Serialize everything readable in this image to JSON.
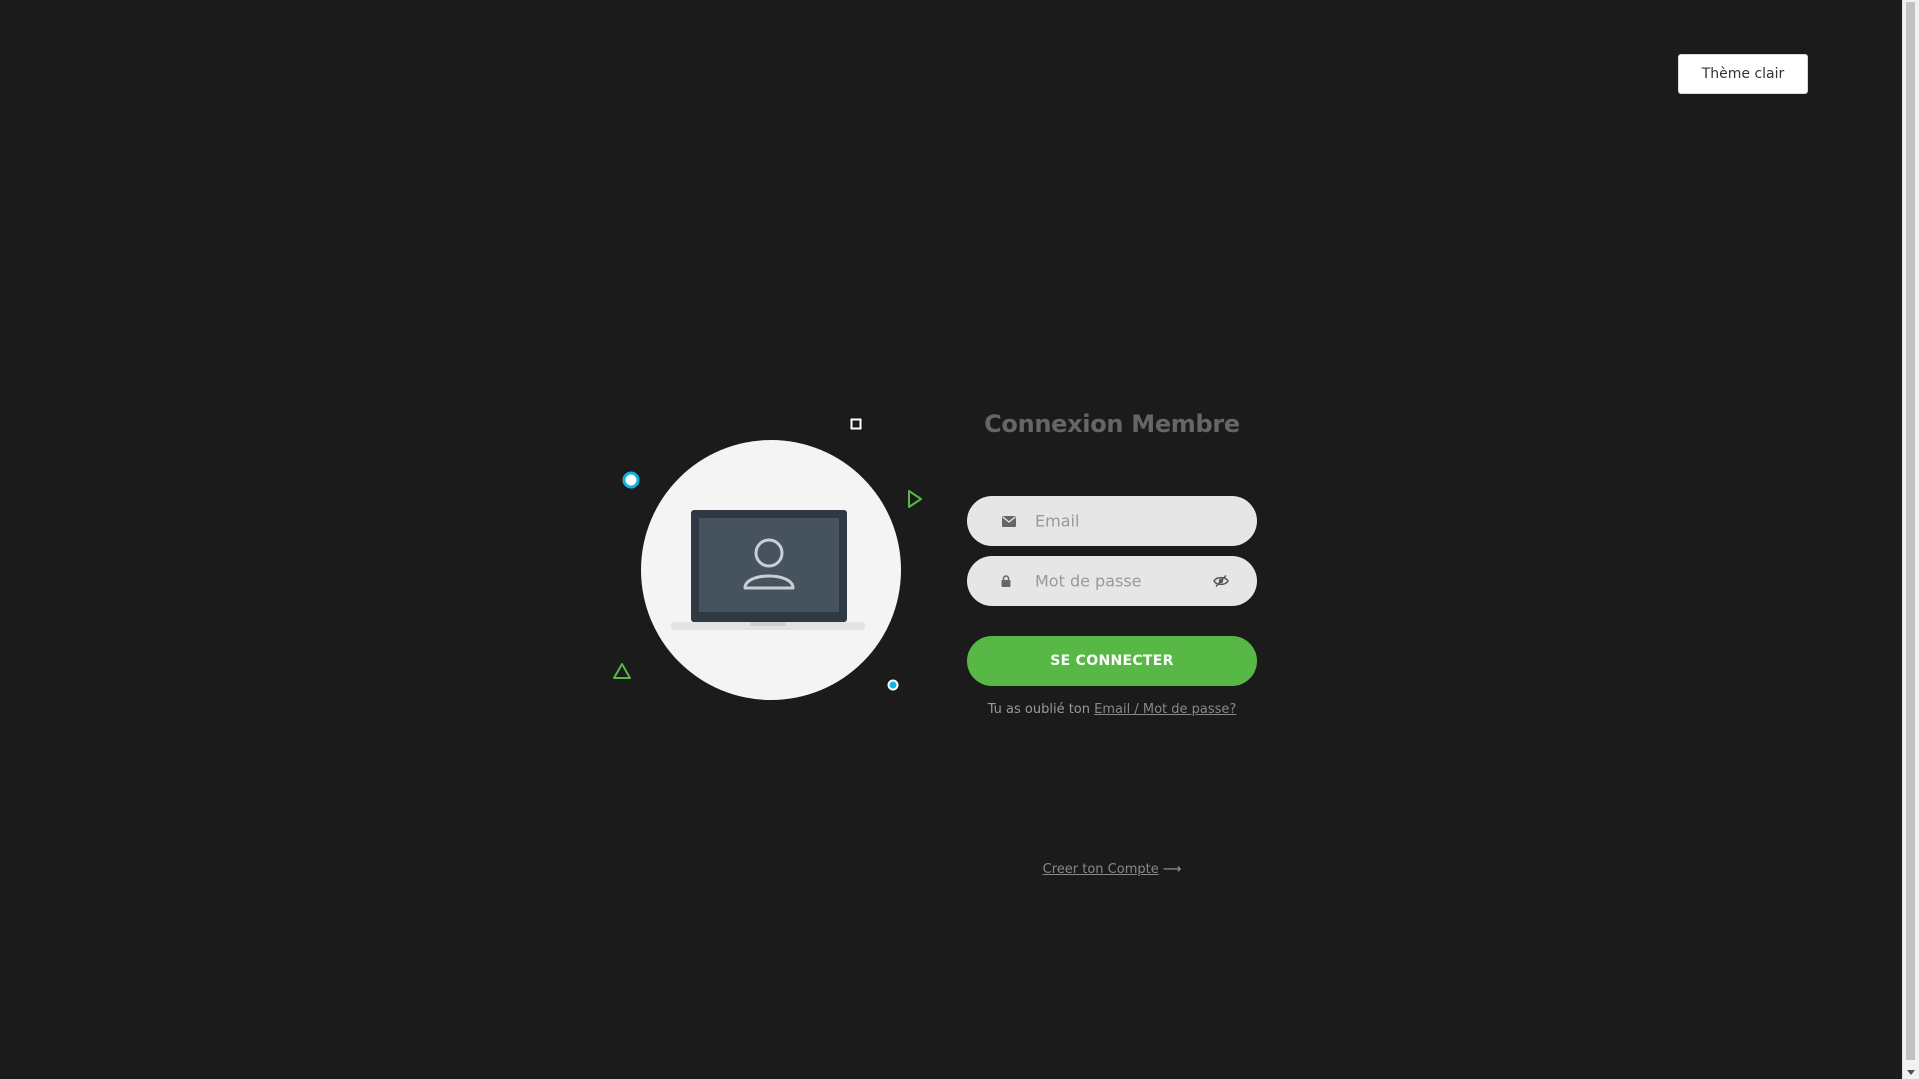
{
  "theme_toggle": {
    "label": "Thème clair"
  },
  "login": {
    "title": "Connexion Membre",
    "email": {
      "placeholder": "Email",
      "icon": "envelope-icon"
    },
    "password": {
      "placeholder": "Mot de passe",
      "icon": "lock-icon",
      "toggle_icon": "eye-slash-icon"
    },
    "submit_label": "SE CONNECTER",
    "forgot_prefix": "Tu as oublié ton",
    "forgot_link": "Email / Mot de passe?",
    "create_account_label": "Creer ton Compte",
    "create_account_arrow": "⟶"
  },
  "colors": {
    "background": "#1b1b1b",
    "accent_green": "#57b846",
    "accent_cyan": "#0fb4e4",
    "field_bg": "#e6e6e6",
    "illustration_bg": "#f4f4f4"
  }
}
